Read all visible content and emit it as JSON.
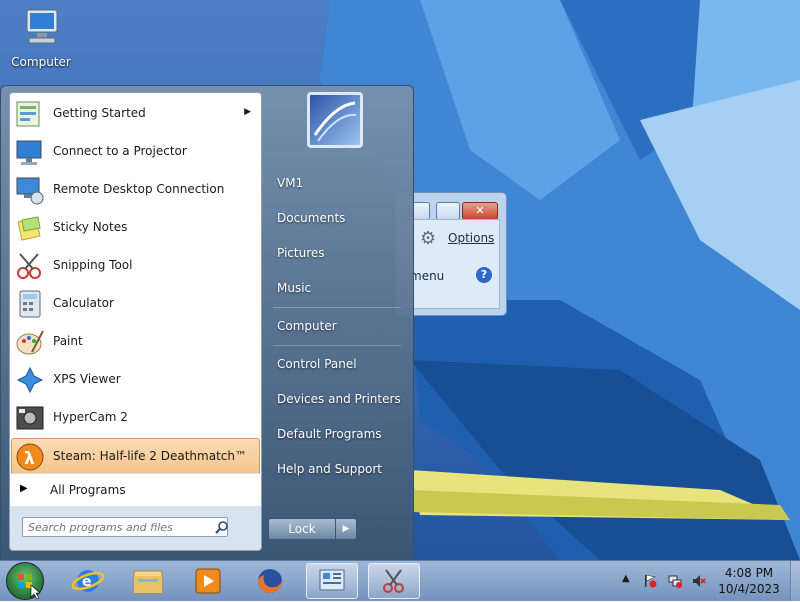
{
  "desktop": {
    "icon_label": "Computer"
  },
  "bg_window": {
    "options_label": "Options",
    "menu_label": "menu",
    "help_glyph": "?"
  },
  "start_menu": {
    "programs": [
      {
        "label": "Getting Started",
        "icon": "getting-started-icon",
        "has_arrow": true
      },
      {
        "label": "Connect to a Projector",
        "icon": "projector-icon"
      },
      {
        "label": "Remote Desktop Connection",
        "icon": "remote-desktop-icon"
      },
      {
        "label": "Sticky Notes",
        "icon": "sticky-notes-icon"
      },
      {
        "label": "Snipping Tool",
        "icon": "snipping-tool-icon"
      },
      {
        "label": "Calculator",
        "icon": "calculator-icon"
      },
      {
        "label": "Paint",
        "icon": "paint-icon"
      },
      {
        "label": "XPS Viewer",
        "icon": "xps-viewer-icon"
      },
      {
        "label": "HyperCam 2",
        "icon": "hypercam-icon"
      },
      {
        "label": "Steam: Half-life 2 Deathmatch™",
        "icon": "half-life-icon",
        "highlighted": true
      }
    ],
    "all_programs": "All Programs",
    "search_placeholder": "Search programs and files",
    "right_items": [
      "VM1",
      "Documents",
      "Pictures",
      "Music",
      "Computer",
      "Control Panel",
      "Devices and Printers",
      "Default Programs",
      "Help and Support"
    ],
    "lock_label": "Lock",
    "lock_arrow": "▶"
  },
  "taskbar": {
    "time": "4:08 PM",
    "date": "10/4/2023"
  },
  "colors": {
    "highlight": "#f5c38a",
    "taskbar": "#7393bd"
  }
}
